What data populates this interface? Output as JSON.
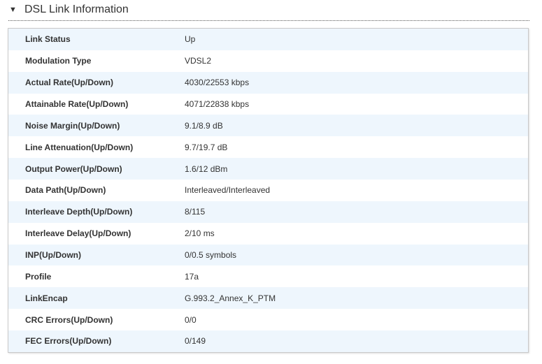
{
  "section": {
    "title": "DSL Link Information",
    "icon": "triangle-down-icon"
  },
  "rows": [
    {
      "label": "Link Status",
      "value": "Up"
    },
    {
      "label": "Modulation Type",
      "value": "VDSL2"
    },
    {
      "label": "Actual Rate(Up/Down)",
      "value": "4030/22553 kbps"
    },
    {
      "label": "Attainable Rate(Up/Down)",
      "value": "4071/22838 kbps"
    },
    {
      "label": "Noise Margin(Up/Down)",
      "value": "9.1/8.9 dB"
    },
    {
      "label": "Line Attenuation(Up/Down)",
      "value": "9.7/19.7 dB"
    },
    {
      "label": "Output Power(Up/Down)",
      "value": "1.6/12 dBm"
    },
    {
      "label": "Data Path(Up/Down)",
      "value": "Interleaved/Interleaved"
    },
    {
      "label": "Interleave Depth(Up/Down)",
      "value": "8/115"
    },
    {
      "label": "Interleave Delay(Up/Down)",
      "value": "2/10 ms"
    },
    {
      "label": "INP(Up/Down)",
      "value": "0/0.5 symbols"
    },
    {
      "label": "Profile",
      "value": "17a"
    },
    {
      "label": "LinkEncap",
      "value": "G.993.2_Annex_K_PTM"
    },
    {
      "label": "CRC Errors(Up/Down)",
      "value": "0/0"
    },
    {
      "label": "FEC Errors(Up/Down)",
      "value": "0/149"
    }
  ]
}
